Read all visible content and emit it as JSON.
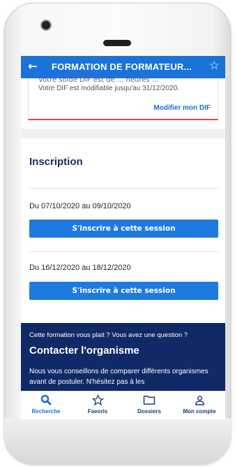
{
  "appbar": {
    "back_icon": "back-arrow-icon",
    "title": "FORMATION DE FORMATEUR...",
    "favorite_icon": "star-outline-icon"
  },
  "dif": {
    "truncated_text": "Votre solde DIF est de ... heures ...",
    "text": "Votre DIF est modifiable jusqu'au 31/12/2020.",
    "link": "Modifier mon DIF"
  },
  "inscription": {
    "title": "Inscription",
    "sessions": [
      {
        "dates": "Du 07/10/2020 au 09/10/2020",
        "button": "S'inscrire à cette session"
      },
      {
        "dates": "Du 16/12/2020 au 18/12/2020",
        "button": "S'inscrire à cette session"
      }
    ]
  },
  "contact": {
    "question": "Cette formation vous plait ? Vous avez une question ?",
    "heading": "Contacter l'organisme",
    "text": "Nous vous conseillons de comparer différents organismes avant de postuler. N'hésitez pas à les"
  },
  "nav": {
    "items": [
      {
        "label": "Recherche",
        "icon": "search-icon",
        "active": true
      },
      {
        "label": "Favoris",
        "icon": "star-icon"
      },
      {
        "label": "Dossiers",
        "icon": "folder-icon"
      },
      {
        "label": "Mon compte",
        "icon": "user-icon"
      }
    ]
  },
  "colors": {
    "primary": "#1a73d9",
    "dark_blue": "#0f2a66",
    "accent_red": "#e6404f"
  }
}
